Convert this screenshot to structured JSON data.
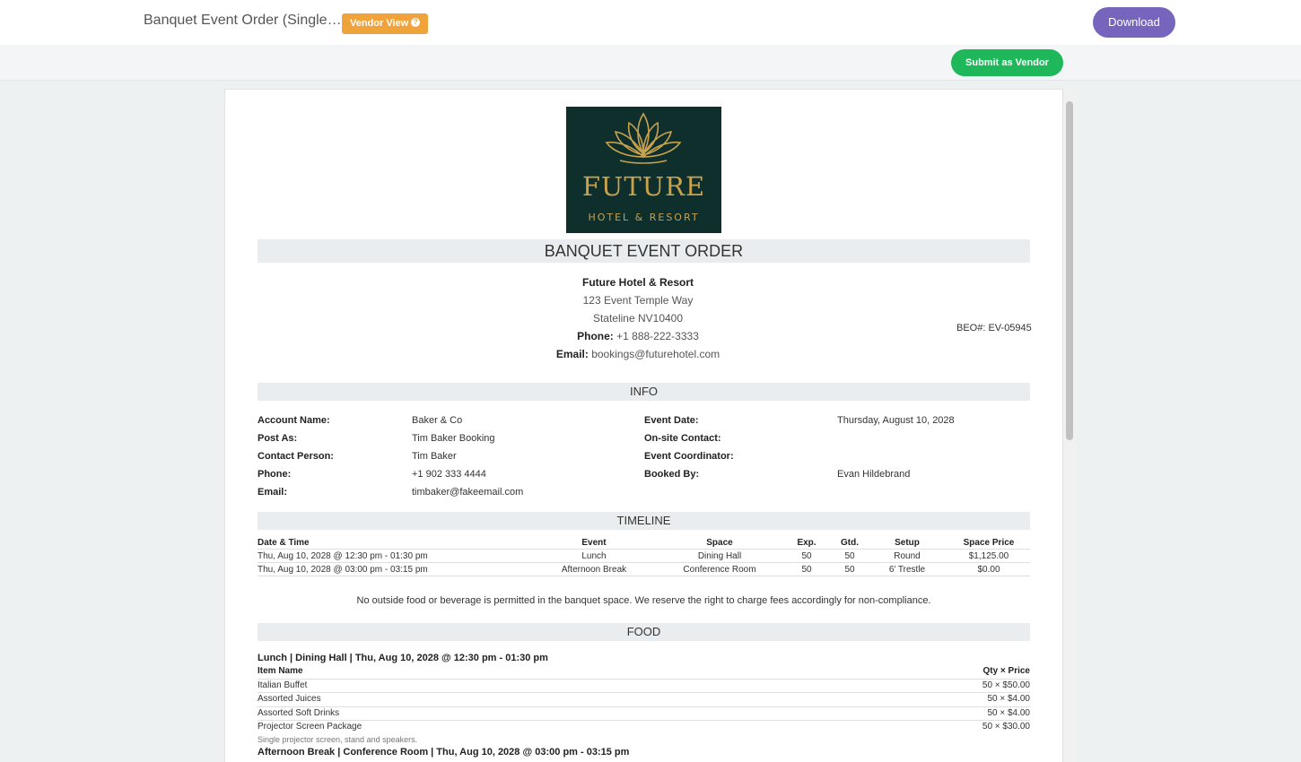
{
  "header": {
    "doc_title": "Banquet Event Order (Single…",
    "vendor_badge": "Vendor View",
    "help_icon": "?",
    "download_label": "Download",
    "submit_label": "Submit as Vendor"
  },
  "logo": {
    "word": "FUTURE",
    "sub": "HOTEL & RESORT"
  },
  "beo": {
    "title": "BANQUET EVENT ORDER",
    "hotel_name": "Future Hotel & Resort",
    "address1": "123 Event Temple Way",
    "address2": "Stateline NV10400",
    "phone_label": "Phone:",
    "phone": "+1 888-222-3333",
    "email_label": "Email:",
    "email": "bookings@futurehotel.com",
    "beo_number": "BEO#: EV-05945"
  },
  "info": {
    "title": "INFO",
    "left": [
      {
        "label": "Account Name:",
        "value": "Baker & Co"
      },
      {
        "label": "Post As:",
        "value": "Tim Baker Booking"
      },
      {
        "label": "Contact Person:",
        "value": "Tim Baker"
      },
      {
        "label": "Phone:",
        "value": "+1 902 333 4444"
      },
      {
        "label": "Email:",
        "value": "timbaker@fakeemail.com"
      }
    ],
    "right": [
      {
        "label": "Event Date:",
        "value": "Thursday, August 10, 2028"
      },
      {
        "label": "On-site Contact:",
        "value": ""
      },
      {
        "label": "Event Coordinator:",
        "value": ""
      },
      {
        "label": "Booked By:",
        "value": "Evan Hildebrand"
      }
    ]
  },
  "timeline": {
    "title": "TIMELINE",
    "headers": [
      "Date & Time",
      "Event",
      "Space",
      "Exp.",
      "Gtd.",
      "Setup",
      "Space Price"
    ],
    "rows": [
      [
        "Thu, Aug 10, 2028 @ 12:30 pm - 01:30 pm",
        "Lunch",
        "Dining Hall",
        "50",
        "50",
        "Round",
        "$1,125.00"
      ],
      [
        "Thu, Aug 10, 2028 @ 03:00 pm - 03:15 pm",
        "Afternoon Break",
        "Conference Room",
        "50",
        "50",
        "6' Trestle",
        "$0.00"
      ]
    ]
  },
  "notice": "No outside food or beverage is permitted in the banquet space.  We reserve the right to charge fees accordingly for non-compliance.",
  "food": {
    "title": "FOOD",
    "group1": "Lunch | Dining Hall | Thu, Aug 10, 2028 @ 12:30 pm - 01:30 pm",
    "col_item": "Item Name",
    "col_qty": "Qty × Price",
    "items": [
      {
        "name": "Italian Buffet",
        "qty": "50 × $50.00"
      },
      {
        "name": "Assorted Juices",
        "qty": "50 × $4.00"
      },
      {
        "name": "Assorted Soft Drinks",
        "qty": "50 × $4.00"
      },
      {
        "name": "Projector Screen Package",
        "qty": "50 × $30.00"
      }
    ],
    "item_note": "Single projector screen, stand and speakers.",
    "group2": "Afternoon Break | Conference Room | Thu, Aug 10, 2028 @ 03:00 pm - 03:15 pm"
  }
}
